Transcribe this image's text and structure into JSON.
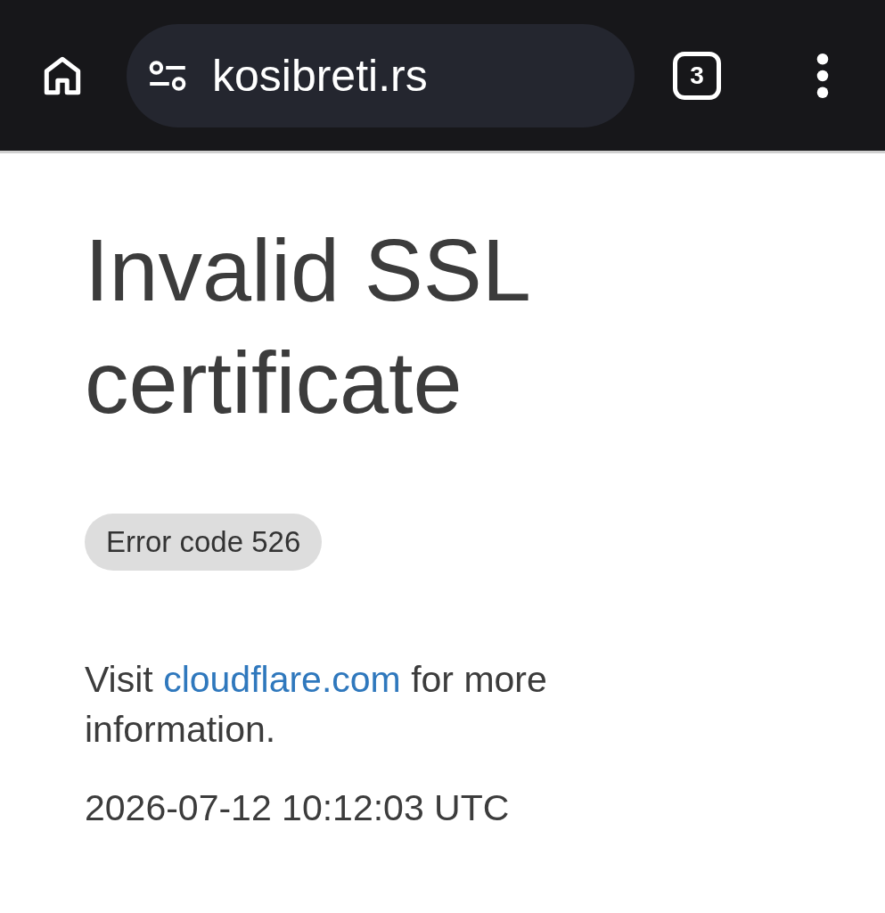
{
  "toolbar": {
    "url": "kosibreti.rs",
    "tab_count": "3"
  },
  "page": {
    "title": "Invalid SSL certificate",
    "error_badge": "Error code 526",
    "info": {
      "before": "Visit",
      "link": "cloudflare.com",
      "after": "for more information."
    },
    "timestamp": "2026-07-12 10:12:03 UTC"
  }
}
